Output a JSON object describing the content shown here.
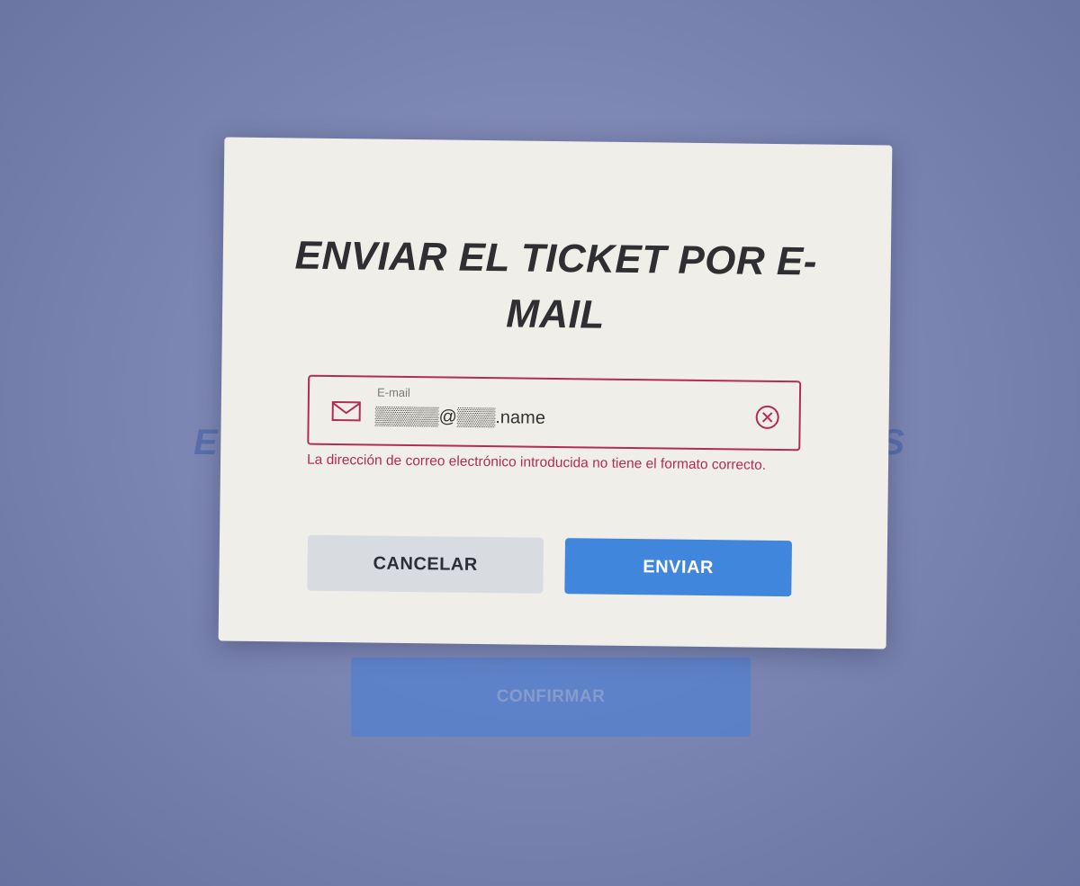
{
  "background": {
    "heading_left_fragment": "E",
    "heading_right_fragment": "S",
    "confirm_label": "CONFIRMAR"
  },
  "dialog": {
    "title": "ENVIAR EL TICKET POR E-MAIL",
    "email_field": {
      "label": "E-mail",
      "value": "▒▒▒▒▒@▒▒▒.name",
      "icon": "mail-icon",
      "clear_icon": "clear-circle-x-icon"
    },
    "error_message": "La dirección de correo electrónico introducida no tiene el formato correcto.",
    "cancel_label": "CANCELAR",
    "send_label": "ENVIAR"
  },
  "colors": {
    "error": "#b22d4e",
    "primary": "#3f86dc",
    "secondary": "#d8dbe0"
  }
}
